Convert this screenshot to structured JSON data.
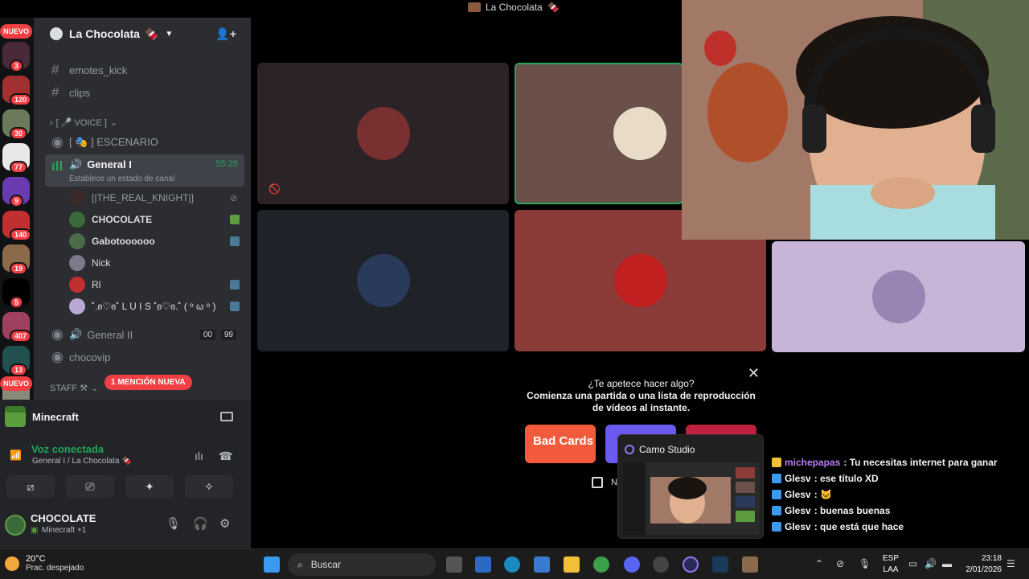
{
  "window": {
    "title": "La Chocolata"
  },
  "rail": {
    "top_badge": "NUEVO",
    "bottom_badge": "NUEVO",
    "servers": [
      {
        "badge": "3",
        "color": "#4a2a3a"
      },
      {
        "badge": "120",
        "color": "#a33030"
      },
      {
        "badge": "30",
        "color": "#6a7a5a"
      },
      {
        "badge": "77",
        "color": "#e8e8e8"
      },
      {
        "badge": "9",
        "color": "#6a3ab0"
      },
      {
        "badge": "140",
        "color": "#c03030"
      },
      {
        "badge": "19",
        "color": "#8a6a4a"
      },
      {
        "badge": "5",
        "color": "#000000"
      },
      {
        "badge": "407",
        "color": "#a04060"
      },
      {
        "badge": "13",
        "color": "#205050"
      },
      {
        "badge": "",
        "color": "#8a8a7a"
      }
    ]
  },
  "server": {
    "name": "La Chocolata"
  },
  "channels": {
    "text": [
      "emotes_kick",
      "clips"
    ],
    "voice_category": "[ 🎤 VOICE ]",
    "stage": "[ 🎭 ] ESCENARIO",
    "active_voice": {
      "name": "General I",
      "time": "55:25",
      "status": "Establece un estado de canal"
    },
    "members": [
      {
        "name": "[|THE_REAL_KNIGHT|]",
        "color": "#3a2a2a",
        "act": "",
        "dim": true
      },
      {
        "name": "CHOCOLATE",
        "color": "#3a6b3a",
        "act": "#5d9c3f",
        "dim": false
      },
      {
        "name": "Gabotoooooo",
        "color": "#4a6a4a",
        "act": "#4a7a9a",
        "dim": false
      },
      {
        "name": "Nick",
        "color": "#7a7a8a",
        "act": "",
        "dim": false
      },
      {
        "name": "Rl",
        "color": "#c03030",
        "act": "#4a7a9a",
        "dim": false
      },
      {
        "name": "˚.ʚ♡ɞ˚ L U I S ˚ʚ♡ɞ.˚ ( ᵒ ω ᵒ )",
        "color": "#b9a8d4",
        "act": "#4a7a9a",
        "dim": false
      }
    ],
    "voice2": {
      "name": "General II",
      "count_a": "00",
      "count_b": "99"
    },
    "other": "chocovip",
    "staff": "STAFF ⚒",
    "mention": "1 MENCIÓN NUEVA"
  },
  "activity": {
    "name": "Minecraft"
  },
  "voice": {
    "title": "Voz conectada",
    "subtitle": "General I / La Chocolata 🍫"
  },
  "user": {
    "name": "CHOCOLATE",
    "status": "Minecraft +1"
  },
  "tiles": [
    {
      "bg": "#2b2325",
      "avatar": "#7a3030"
    },
    {
      "bg": "#6a5048",
      "avatar": "#e8dcc8",
      "speaking": true
    },
    {
      "bg": "#1f2229",
      "avatar": "#2a3a5a"
    },
    {
      "bg": "#8c3c38",
      "avatar": "#c02020"
    },
    {
      "bg": "#c7b4d6",
      "avatar": "#9a84b4"
    }
  ],
  "prompt": {
    "line1": "¿Te apetece hacer algo?",
    "line2": "Comienza una partida o una lista de reproducción de vídeos al instante.",
    "checkbox_label": "N",
    "games": [
      {
        "label": "Bad Cards",
        "color": "#f15a3a"
      },
      {
        "label": "",
        "color": "#6a5af0"
      },
      {
        "label": "",
        "color": "#c02040"
      }
    ]
  },
  "preview": {
    "title": "Camo Studio"
  },
  "chat": [
    {
      "user": "michepapas",
      "text": ": Tu necesitas internet para ganar",
      "purple": true,
      "icon": "#f2c037"
    },
    {
      "user": "Glesv",
      "text": ": ese título XD",
      "purple": false,
      "icon": "#3a9af0"
    },
    {
      "user": "Glesv",
      "text": ": 🐱",
      "purple": false,
      "icon": "#3a9af0"
    },
    {
      "user": "Glesv",
      "text": ": buenas buenas",
      "purple": false,
      "icon": "#3a9af0"
    },
    {
      "user": "Glesv",
      "text": ": que está que hace",
      "purple": false,
      "icon": "#3a9af0"
    }
  ],
  "taskbar": {
    "temp": "20°C",
    "weather": "Prac. despejado",
    "search": "Buscar",
    "lang1": "ESP",
    "lang2": "LAA",
    "time": "23:18",
    "date": "2/01/2026"
  }
}
